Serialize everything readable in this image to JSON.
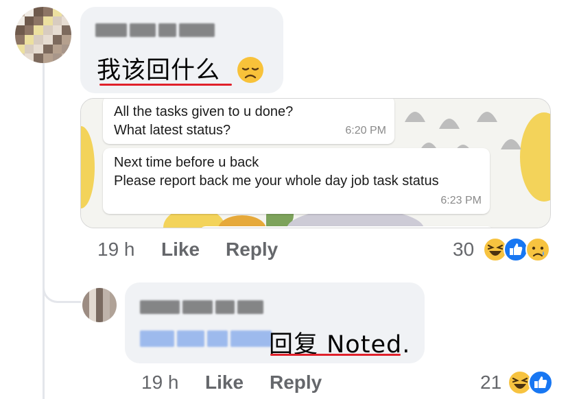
{
  "comment1": {
    "author_blurred": "Jingle Bell",
    "text": "我该回什么",
    "emoji_icon": "disappointed-face-emoji",
    "timestamp": "19 h",
    "like_label": "Like",
    "reply_label": "Reply",
    "reaction_count": "30",
    "reactions": [
      "haha-reaction-icon",
      "like-reaction-icon",
      "sad-reaction-icon"
    ]
  },
  "chat_screenshot": {
    "messages": [
      {
        "lines": [
          "All the tasks given to u done?",
          "What latest status?"
        ],
        "time": "6:20 PM"
      },
      {
        "lines": [
          "Next time before u back",
          "Please report back me your whole day job task status"
        ],
        "time": "6:23 PM"
      }
    ]
  },
  "reply1": {
    "author_blurred": "Phoebe Lye",
    "mention_blurred": "Jingle Bell",
    "text": "回复 Noted.",
    "timestamp": "19 h",
    "like_label": "Like",
    "reply_label": "Reply",
    "reaction_count": "21",
    "reactions": [
      "haha-reaction-icon",
      "like-reaction-icon"
    ]
  },
  "colors": {
    "bubble": "#f0f2f5",
    "meta_text": "#65676b",
    "underline": "#e0202a",
    "like_blue": "#1877f2",
    "haha_yellow": "#f7c340"
  }
}
